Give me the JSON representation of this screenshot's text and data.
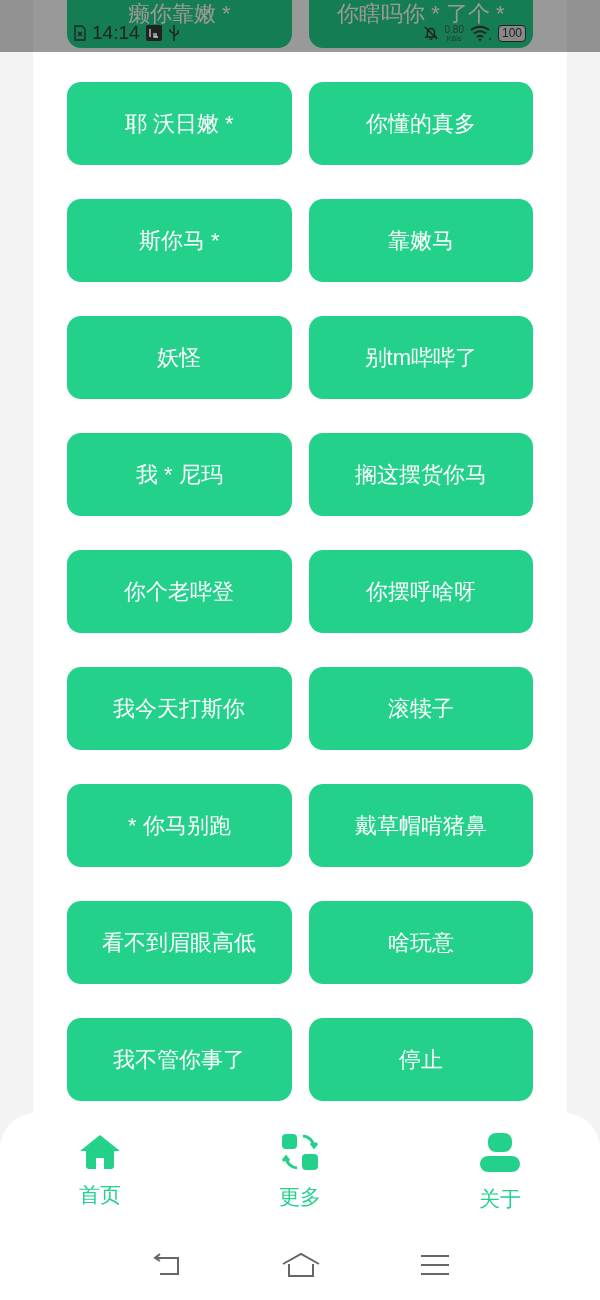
{
  "status_bar": {
    "time": "14:14",
    "net_speed": "0.80",
    "net_unit": "KB/s",
    "battery": "100"
  },
  "buttons": [
    "癞你靠嫩 *",
    "你瞎吗你 * 了个 *",
    "耶 沃日嫩 *",
    "你懂的真多",
    "斯你马 *",
    "靠嫩马",
    "妖怪",
    "别tm哔哔了",
    "我 * 尼玛",
    "搁这摆货你马",
    "你个老哔登",
    "你摆呼啥呀",
    "我今天打斯你",
    "滚犊子",
    "* 你马别跑",
    "戴草帽啃猪鼻",
    "看不到眉眼高低",
    "啥玩意",
    "我不管你事了",
    "停止"
  ],
  "tabs": [
    {
      "kind": "home",
      "label": "首页"
    },
    {
      "kind": "more",
      "label": "更多"
    },
    {
      "kind": "about",
      "label": "关于"
    }
  ]
}
